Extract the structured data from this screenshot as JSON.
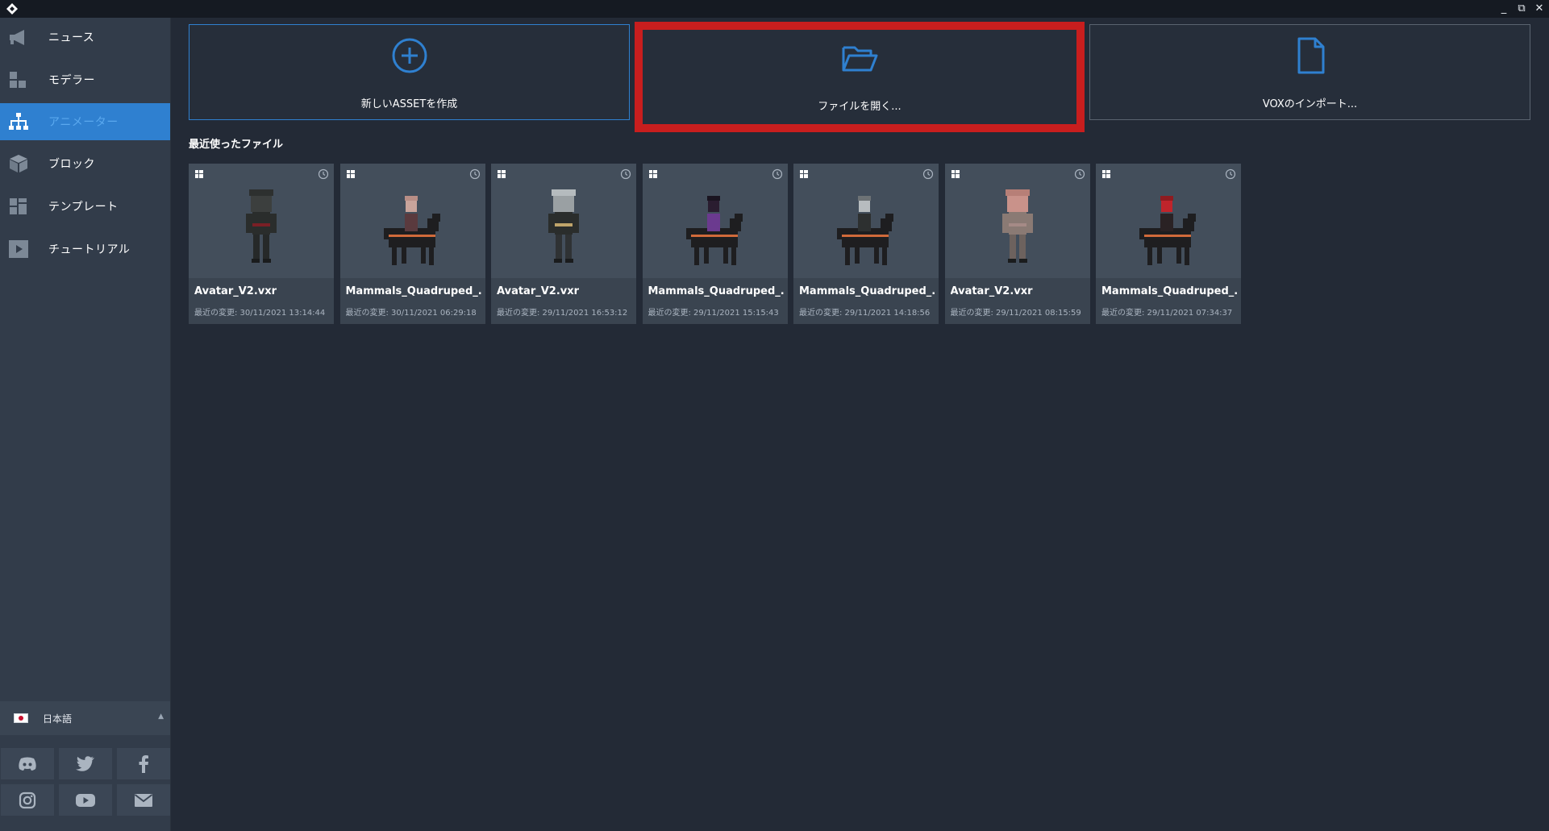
{
  "window": {
    "controls": {
      "minimize": "_",
      "restore": "⧉",
      "close": "✕"
    }
  },
  "sidebar": {
    "items": [
      {
        "label": "ニュース",
        "icon": "megaphone-icon"
      },
      {
        "label": "モデラー",
        "icon": "blocks-icon"
      },
      {
        "label": "アニメーター",
        "icon": "hierarchy-icon",
        "active": true
      },
      {
        "label": "ブロック",
        "icon": "cube-icon"
      },
      {
        "label": "テンプレート",
        "icon": "template-icon"
      },
      {
        "label": "チュートリアル",
        "icon": "play-icon"
      }
    ],
    "language": {
      "label": "日本語",
      "flag": "japan-flag-icon"
    },
    "social": [
      "discord-icon",
      "twitter-icon",
      "facebook-icon",
      "instagram-icon",
      "youtube-icon",
      "mail-icon"
    ]
  },
  "actions": [
    {
      "label": "新しいASSETを作成",
      "icon": "plus-circle-icon"
    },
    {
      "label": "ファイルを開く...",
      "icon": "folder-open-icon"
    },
    {
      "label": "VOXのインポート...",
      "icon": "file-icon"
    }
  ],
  "recent": {
    "title": "最近使ったファイル",
    "files": [
      {
        "name": "Avatar_V2.vxr",
        "date": "最近の変更: 30/11/2021 13:14:44",
        "figure": "avatar-dark"
      },
      {
        "name": "Mammals_Quadruped_...",
        "date": "最近の変更: 30/11/2021 06:29:18",
        "figure": "rider-pink"
      },
      {
        "name": "Avatar_V2.vxr",
        "date": "最近の変更: 29/11/2021 16:53:12",
        "figure": "avatar-helmet"
      },
      {
        "name": "Mammals_Quadruped_...",
        "date": "最近の変更: 29/11/2021 15:15:43",
        "figure": "rider-purple"
      },
      {
        "name": "Mammals_Quadruped_...",
        "date": "最近の変更: 29/11/2021 14:18:56",
        "figure": "rider-grey"
      },
      {
        "name": "Avatar_V2.vxr",
        "date": "最近の変更: 29/11/2021 08:15:59",
        "figure": "avatar-pig"
      },
      {
        "name": "Mammals_Quadruped_...",
        "date": "最近の変更: 29/11/2021 07:34:37",
        "figure": "rider-red"
      }
    ]
  },
  "colors": {
    "accent": "#2f80d0",
    "highlight": "#c81e1e",
    "background": "#232a36",
    "sidebar": "#323c4a"
  }
}
